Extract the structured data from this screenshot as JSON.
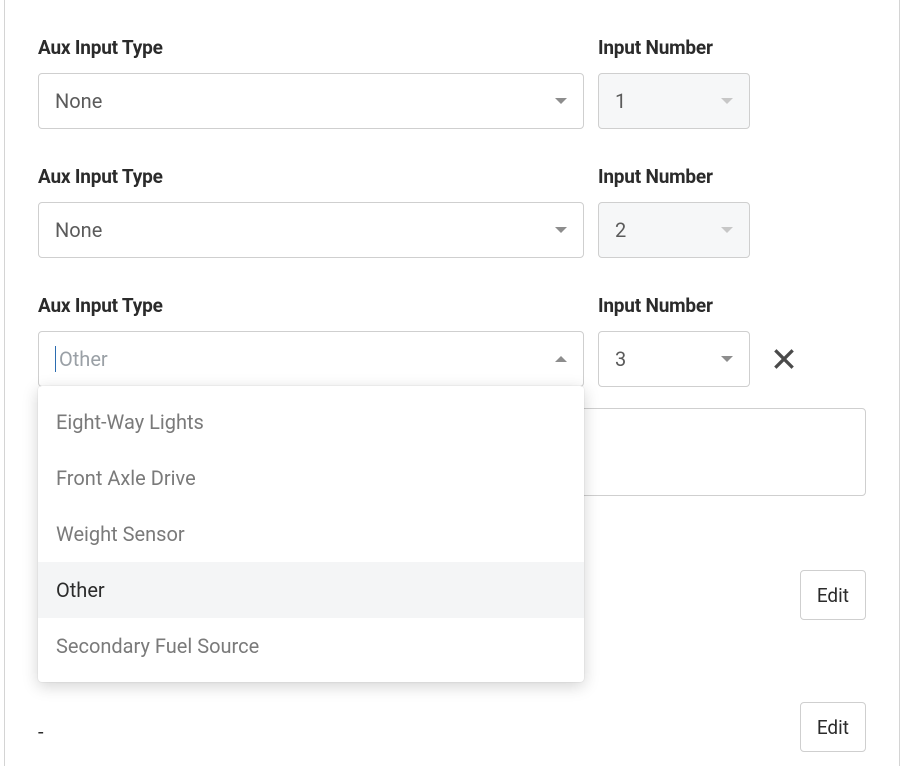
{
  "labels": {
    "aux_input_type": "Aux Input Type",
    "input_number": "Input Number"
  },
  "rows": [
    {
      "aux_value": "None",
      "input_number": "1"
    },
    {
      "aux_value": "None",
      "input_number": "2"
    },
    {
      "aux_value": "Other",
      "input_number": "3"
    }
  ],
  "dropdown_options": [
    "Eight-Way Lights",
    "Front Axle Drive",
    "Weight Sensor",
    "Other",
    "Secondary Fuel Source"
  ],
  "dropdown_selected": "Other",
  "buttons": {
    "edit": "Edit"
  },
  "dash": "-"
}
